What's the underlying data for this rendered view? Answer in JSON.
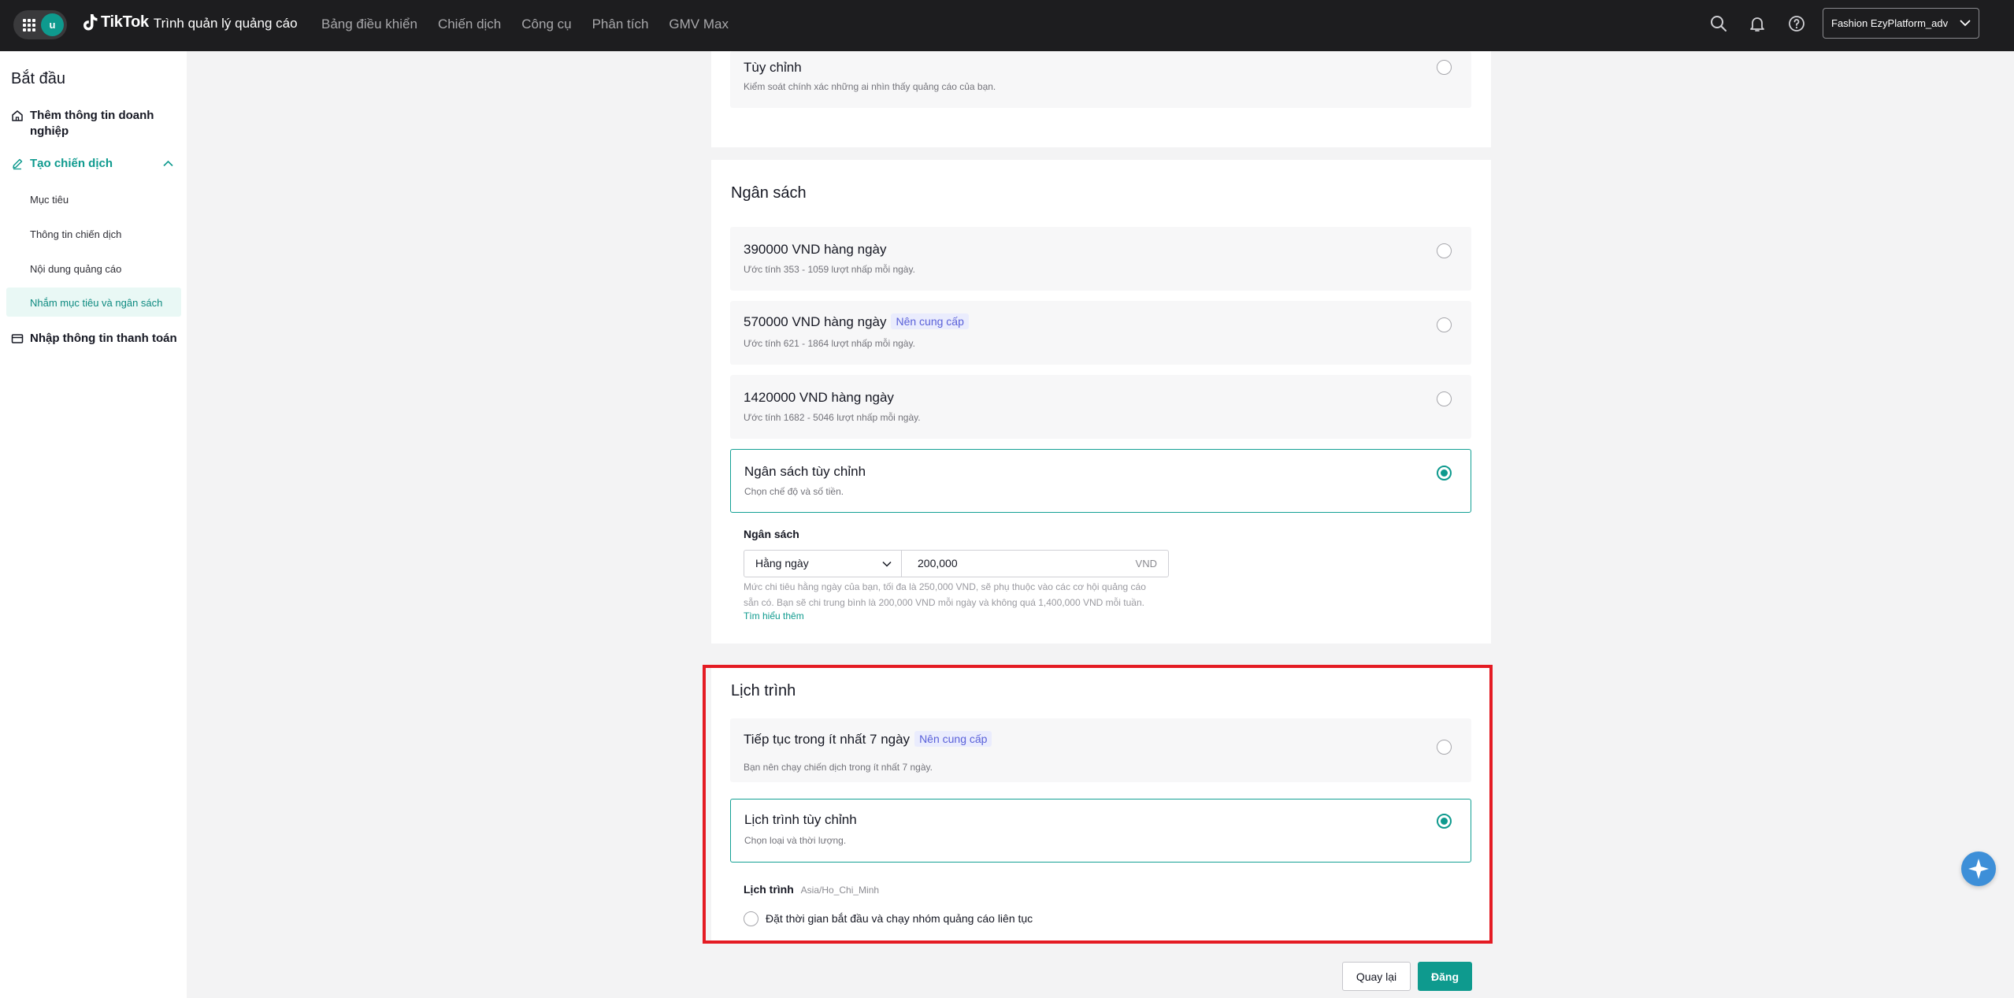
{
  "topbar": {
    "avatar_letter": "u",
    "brand_logo": "TikTok",
    "brand_sub": "Trình quản lý quảng cáo",
    "nav": [
      "Bảng điều khiển",
      "Chiến dịch",
      "Công cụ",
      "Phân tích",
      "GMV Max"
    ],
    "account": "Fashion EzyPlatform_adv",
    "icons": [
      "search-icon",
      "bell-icon",
      "help-icon"
    ]
  },
  "sidebar": {
    "title": "Bắt đầu",
    "business_info": "Thêm thông tin doanh nghiệp",
    "create_campaign": "Tạo chiến dịch",
    "steps": [
      "Mục tiêu",
      "Thông tin chiến dịch",
      "Nội dung quảng cáo",
      "Nhắm mục tiêu và ngân sách"
    ],
    "payment": "Nhập thông tin thanh toán"
  },
  "audience": {
    "custom_title": "Tùy chỉnh",
    "custom_desc": "Kiểm soát chính xác những ai nhìn thấy quảng cáo của bạn."
  },
  "budget": {
    "title": "Ngân sách",
    "options": [
      {
        "title": "390000 VND hàng ngày",
        "desc": "Ước tính 353 - 1059 lượt nhấp mỗi ngày."
      },
      {
        "title": "570000 VND hàng ngày",
        "badge": "Nên cung cấp",
        "desc": "Ước tính 621 - 1864 lượt nhấp mỗi ngày."
      },
      {
        "title": "1420000 VND hàng ngày",
        "desc": "Ước tính 1682 - 5046 lượt nhấp mỗi ngày."
      },
      {
        "title": "Ngân sách tùy chỉnh",
        "desc": "Chọn chế độ và số tiền."
      }
    ],
    "field_label": "Ngân sách",
    "mode": "Hằng ngày",
    "amount": "200,000",
    "unit": "VND",
    "help_line1": "Mức chi tiêu hằng ngày của bạn, tối đa là 250,000 VND, sẽ phụ thuộc vào các cơ hội quảng cáo",
    "help_line2": "sẵn có. Bạn sẽ chi trung bình là 200,000 VND mỗi ngày và không quá 1,400,000 VND mỗi tuần.",
    "learn_more": "Tìm hiểu thêm"
  },
  "schedule": {
    "title": "Lịch trình",
    "options": [
      {
        "title": "Tiếp tục trong ít nhất 7 ngày",
        "badge": "Nên cung cấp",
        "desc": "Bạn nên chạy chiến dịch trong ít nhất 7 ngày."
      },
      {
        "title": "Lịch trình tùy chỉnh",
        "desc": "Chọn loại và thời lượng."
      }
    ],
    "field_label": "Lịch trình",
    "timezone": "Asia/Ho_Chi_Minh",
    "continuous_option": "Đặt thời gian bắt đầu và chạy nhóm quảng cáo liên tục"
  },
  "footer": {
    "back": "Quay lại",
    "publish": "Đăng"
  }
}
